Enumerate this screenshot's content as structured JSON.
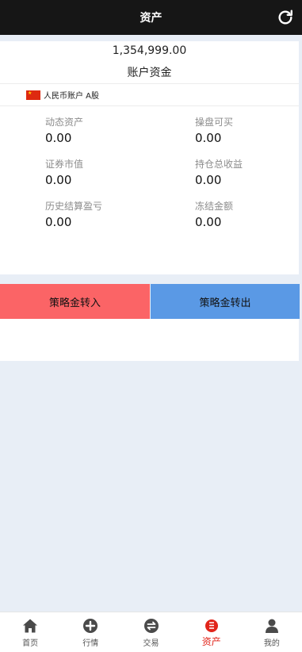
{
  "header": {
    "title": "资产"
  },
  "account": {
    "balance": "1,354,999.00",
    "balance_label": "账户资金",
    "account_name": "人民币账户 A股"
  },
  "stats": [
    {
      "label": "动态资产",
      "value": "0.00"
    },
    {
      "label": "操盘可买",
      "value": "0.00"
    },
    {
      "label": "证券市值",
      "value": "0.00"
    },
    {
      "label": "持仓总收益",
      "value": "0.00"
    },
    {
      "label": "历史结算盈亏",
      "value": "0.00"
    },
    {
      "label": "冻结金额",
      "value": "0.00"
    }
  ],
  "actions": {
    "transfer_in": "策略金转入",
    "transfer_out": "策略金转出"
  },
  "tabbar": {
    "items": [
      {
        "label": "首页",
        "icon": "home-icon"
      },
      {
        "label": "行情",
        "icon": "plus-circle-icon"
      },
      {
        "label": "交易",
        "icon": "swap-icon"
      },
      {
        "label": "资产",
        "icon": "assets-icon",
        "active": true
      },
      {
        "label": "我的",
        "icon": "user-icon"
      }
    ]
  },
  "colors": {
    "header_bg": "#161616",
    "transfer_in_bg": "#fb6466",
    "transfer_out_bg": "#5a99e5",
    "active_tab": "#e1251b",
    "page_bg": "#e8eef6"
  }
}
